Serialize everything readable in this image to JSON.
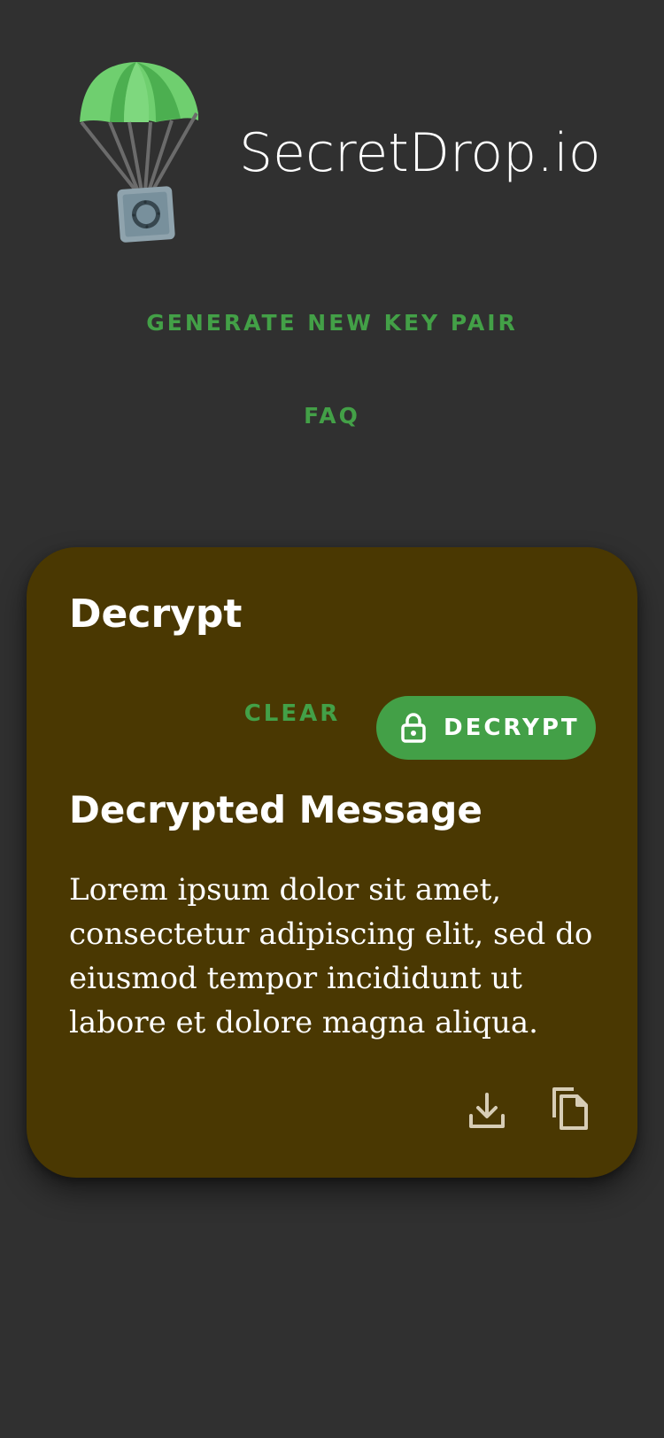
{
  "app": {
    "title": "SecretDrop.io",
    "logo_icon": "parachute-safe-icon"
  },
  "nav": {
    "generate_label": "GENERATE NEW KEY PAIR",
    "faq_label": "FAQ"
  },
  "card": {
    "title": "Decrypt",
    "clear_label": "CLEAR",
    "decrypt_label": "DECRYPT",
    "decrypt_icon": "lock-icon",
    "section_title": "Decrypted Message",
    "message": "Lorem ipsum dolor sit amet, consectetur adipiscing elit, sed do eiusmod tempor incididunt ut labore et dolore magna aliqua.",
    "actions": [
      {
        "icon": "download-icon"
      },
      {
        "icon": "copy-icon"
      }
    ]
  },
  "colors": {
    "background": "#303030",
    "card": "#4a3802",
    "accent": "#43a047",
    "text": "#ffffff"
  }
}
